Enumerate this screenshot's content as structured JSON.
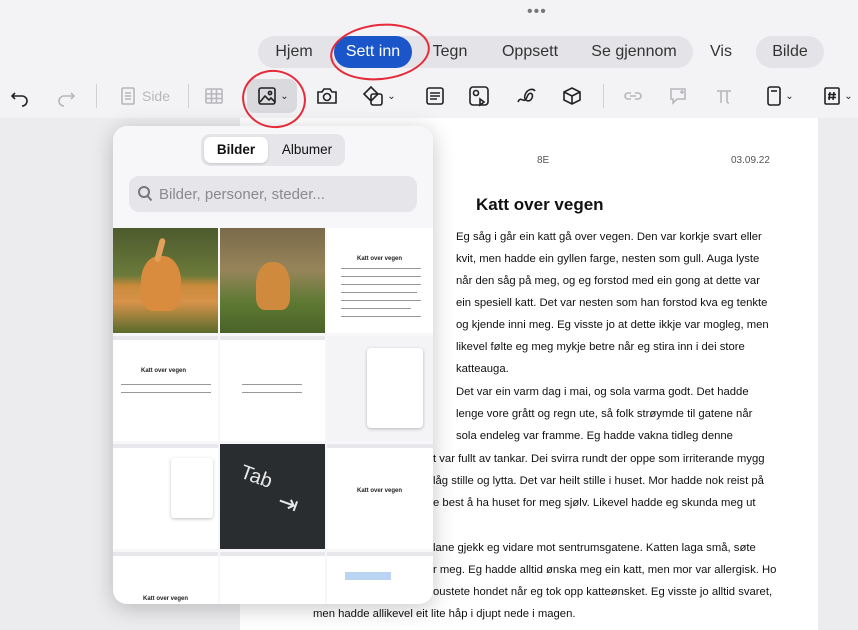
{
  "chrome": {
    "more_dots": "•••"
  },
  "tabs": [
    {
      "label": "Hjem",
      "active": false
    },
    {
      "label": "Sett inn",
      "active": true
    },
    {
      "label": "Tegn",
      "active": false
    },
    {
      "label": "Oppsett",
      "active": false
    },
    {
      "label": "Se gjennom",
      "active": false
    },
    {
      "label": "Vis",
      "active": false
    },
    {
      "label": "Bilde",
      "active": false
    }
  ],
  "toolbar": {
    "page_label": "Side",
    "icons": [
      "undo-icon",
      "redo-icon",
      "page-icon",
      "table-icon",
      "image-icon",
      "camera-icon",
      "shapes-icon",
      "textbox-icon",
      "media-icon",
      "drawing-icon",
      "3d-object-icon",
      "link-icon",
      "comment-icon",
      "equation-icon",
      "device-icon",
      "page-number-icon"
    ]
  },
  "colors": {
    "accent": "#1a56c9",
    "annotation": "#e52b3a"
  },
  "popover": {
    "segments": [
      "Bilder",
      "Albumer"
    ],
    "selected_segment": "Bilder",
    "search_placeholder": "Bilder, personer, steder...",
    "thumb_doc_title": "Katt over vegen",
    "thumb_tab_label": "Tab"
  },
  "document": {
    "class": "8E",
    "date": "03.09.22",
    "title": "Katt over vegen",
    "lines": [
      "Eg såg i går ein katt gå over vegen. Den var korkje svart eller",
      "kvit, men hadde ein gyllen farge, nesten som gull. Auga lyste",
      "når den såg på meg, og eg forstod med ein gong at dette var",
      "ein spesiell katt. Det var nesten som han forstod kva eg tenkte",
      "og kjende inni meg. Eg visste jo at dette ikkje var mogleg, men",
      "likevel følte eg meg mykje betre når eg stira inn i dei store",
      "katteauga.",
      "Det var ein varm dag i mai, og sola varma godt. Det hadde",
      "lenge vore grått og regn ute, så folk strøymde til gatene når",
      "sola endeleg var framme. Eg hadde vakna tidleg denne",
      "t var fullt av tankar. Dei svirra rundt der oppe som irriterande mygg",
      "låg stille og lytta. Det var heilt stille i huset. Mor hadde nok reist på",
      "e best å ha huset for meg sjølv. Likevel hadde eg skunda meg ut",
      "lane gjekk eg vidare mot sentrumsgatene. Katten laga små, søte",
      "r meg. Eg hadde alltid ønska meg ein katt, men mor var allergisk. Ho",
      "oustete hondet når eg tok opp katteønsket. Eg visste jo alltid svaret,",
      "men hadde allikevel eit lite håp i djupt nede i magen."
    ]
  }
}
